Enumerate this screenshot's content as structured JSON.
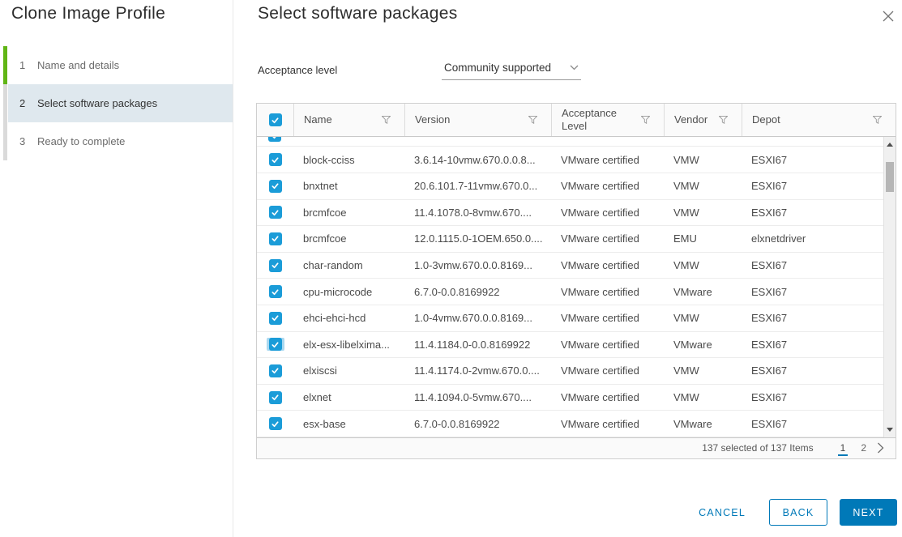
{
  "sidebar": {
    "title": "Clone Image Profile",
    "current_step_index": 1,
    "steps": [
      {
        "number": "1",
        "label": "Name and details"
      },
      {
        "number": "2",
        "label": "Select software packages"
      },
      {
        "number": "3",
        "label": "Ready to complete"
      }
    ]
  },
  "main": {
    "title": "Select software packages",
    "acceptance_level": {
      "label": "Acceptance level",
      "value": "Community supported"
    }
  },
  "table": {
    "select_all_checked": true,
    "columns": [
      {
        "label": "Name"
      },
      {
        "label": "Version"
      },
      {
        "label": "Acceptance Level"
      },
      {
        "label": "Vendor"
      },
      {
        "label": "Depot"
      }
    ],
    "rows": [
      {
        "checked": true,
        "focused": false,
        "name": "block-cciss",
        "version": "3.6.14-10vmw.670.0.0.8...",
        "acceptance_level": "VMware certified",
        "vendor": "VMW",
        "depot": "ESXI67"
      },
      {
        "checked": true,
        "focused": false,
        "name": "bnxtnet",
        "version": "20.6.101.7-11vmw.670.0...",
        "acceptance_level": "VMware certified",
        "vendor": "VMW",
        "depot": "ESXI67"
      },
      {
        "checked": true,
        "focused": false,
        "name": "brcmfcoe",
        "version": "11.4.1078.0-8vmw.670....",
        "acceptance_level": "VMware certified",
        "vendor": "VMW",
        "depot": "ESXI67"
      },
      {
        "checked": true,
        "focused": false,
        "name": "brcmfcoe",
        "version": "12.0.1115.0-1OEM.650.0....",
        "acceptance_level": "VMware certified",
        "vendor": "EMU",
        "depot": "elxnetdriver"
      },
      {
        "checked": true,
        "focused": false,
        "name": "char-random",
        "version": "1.0-3vmw.670.0.0.8169...",
        "acceptance_level": "VMware certified",
        "vendor": "VMW",
        "depot": "ESXI67"
      },
      {
        "checked": true,
        "focused": false,
        "name": "cpu-microcode",
        "version": "6.7.0-0.0.8169922",
        "acceptance_level": "VMware certified",
        "vendor": "VMware",
        "depot": "ESXI67"
      },
      {
        "checked": true,
        "focused": false,
        "name": "ehci-ehci-hcd",
        "version": "1.0-4vmw.670.0.0.8169...",
        "acceptance_level": "VMware certified",
        "vendor": "VMW",
        "depot": "ESXI67"
      },
      {
        "checked": true,
        "focused": true,
        "name": "elx-esx-libelxima...",
        "version": "11.4.1184.0-0.0.8169922",
        "acceptance_level": "VMware certified",
        "vendor": "VMware",
        "depot": "ESXI67"
      },
      {
        "checked": true,
        "focused": false,
        "name": "elxiscsi",
        "version": "11.4.1174.0-2vmw.670.0....",
        "acceptance_level": "VMware certified",
        "vendor": "VMW",
        "depot": "ESXI67"
      },
      {
        "checked": true,
        "focused": false,
        "name": "elxnet",
        "version": "11.4.1094.0-5vmw.670....",
        "acceptance_level": "VMware certified",
        "vendor": "VMW",
        "depot": "ESXI67"
      },
      {
        "checked": true,
        "focused": false,
        "name": "esx-base",
        "version": "6.7.0-0.0.8169922",
        "acceptance_level": "VMware certified",
        "vendor": "VMware",
        "depot": "ESXI67"
      }
    ],
    "footer": {
      "selection_summary": "137 selected of 137 Items",
      "pages": [
        "1",
        "2"
      ],
      "active_page": "1"
    }
  },
  "actions": {
    "cancel_label": "CANCEL",
    "back_label": "BACK",
    "next_label": "NEXT"
  },
  "colors": {
    "primary_blue": "#0079B8",
    "checkbox_blue": "#1B9CD8",
    "step_green": "#60B515",
    "step_active_bg": "#DFE8EE"
  }
}
